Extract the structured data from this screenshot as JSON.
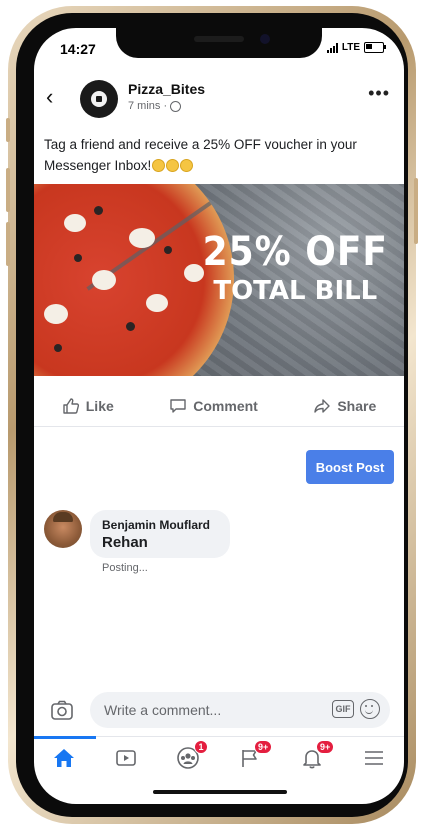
{
  "status": {
    "time": "14:27",
    "network": "LTE"
  },
  "post": {
    "page_name": "Pizza_Bites",
    "meta": "7 mins · ",
    "text": "Tag a friend and receive a 25% OFF voucher in your Messenger Inbox!",
    "promo_big": "25% OFF",
    "promo_small": "TOTAL BILL"
  },
  "actions": {
    "like": "Like",
    "comment": "Comment",
    "share": "Share"
  },
  "boost_label": "Boost Post",
  "comment": {
    "author": "Benjamin Mouflard",
    "text": "Rehan",
    "status": "Posting..."
  },
  "composer": {
    "placeholder": "Write a comment...",
    "gif": "GIF"
  },
  "tabbar": {
    "items": [
      {
        "icon": "home-icon"
      },
      {
        "icon": "video-icon"
      },
      {
        "icon": "groups-icon",
        "badge": "1"
      },
      {
        "icon": "flag-icon",
        "badge": "9+"
      },
      {
        "icon": "bell-icon",
        "badge": "9+"
      },
      {
        "icon": "menu-icon"
      }
    ]
  },
  "colors": {
    "accent": "#1877f2",
    "boost": "#4a7fe8",
    "badge": "#e41e3f"
  }
}
